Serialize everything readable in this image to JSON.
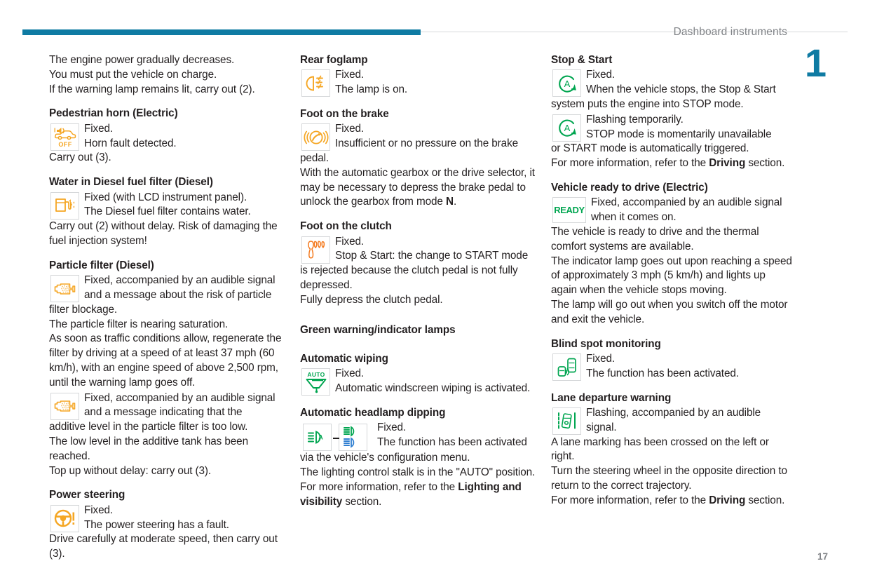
{
  "header": {
    "title": "Dashboard instruments",
    "chapter": "1",
    "page": "17"
  },
  "colors": {
    "accent": "#0f7ba3",
    "amber": "#f5a623",
    "green": "#00a550",
    "header_text": "#808387",
    "body_text": "#231f20",
    "icon_border": "#d5d7d9"
  },
  "columns": [
    {
      "blocks": [
        {
          "type": "paragraph",
          "text": "The engine power gradually decreases."
        },
        {
          "type": "paragraph",
          "text": "You must put the vehicle on charge."
        },
        {
          "type": "paragraph",
          "text": "If the warning lamp remains lit, carry out (2)."
        },
        {
          "type": "heading",
          "text": "Pedestrian horn (Electric)"
        },
        {
          "type": "lamp",
          "icon": "pedestrian-horn-off-icon",
          "line1": "Fixed.",
          "line2": "Horn fault detected."
        },
        {
          "type": "paragraph",
          "text": "Carry out (3)."
        },
        {
          "type": "heading",
          "text": "Water in Diesel fuel filter (Diesel)"
        },
        {
          "type": "lamp",
          "icon": "diesel-fuel-filter-water-icon",
          "line1": "Fixed (with LCD instrument panel).",
          "line2": "The Diesel fuel filter contains water."
        },
        {
          "type": "paragraph",
          "text": "Carry out (2) without delay. Risk of damaging the fuel injection system!"
        },
        {
          "type": "heading",
          "text": "Particle filter (Diesel)"
        },
        {
          "type": "lamp",
          "icon": "particle-filter-icon",
          "line1": "Fixed, accompanied by an audible signal",
          "line2": "and a message about the risk of particle"
        },
        {
          "type": "paragraph",
          "text": "filter blockage."
        },
        {
          "type": "paragraph",
          "text": "The particle filter is nearing saturation."
        },
        {
          "type": "paragraph",
          "text": "As soon as traffic conditions allow, regenerate the filter by driving at a speed of at least 37 mph (60 km/h), with an engine speed of above 2,500 rpm, until the warning lamp goes off."
        },
        {
          "type": "lamp",
          "icon": "particle-filter-additive-icon",
          "line1": "Fixed, accompanied by an audible signal",
          "line2": "and a message indicating that the"
        },
        {
          "type": "paragraph",
          "text": "additive level in the particle filter is too low."
        },
        {
          "type": "paragraph",
          "text": "The low level in the additive tank has been reached."
        },
        {
          "type": "paragraph",
          "text": "Top up without delay: carry out (3)."
        },
        {
          "type": "heading",
          "text": "Power steering"
        },
        {
          "type": "lamp",
          "icon": "power-steering-fault-icon",
          "line1": "Fixed.",
          "line2": "The power steering has a fault."
        },
        {
          "type": "paragraph",
          "text": "Drive carefully at moderate speed, then carry out (3)."
        }
      ]
    },
    {
      "blocks": [
        {
          "type": "heading",
          "text": "Rear foglamp"
        },
        {
          "type": "lamp",
          "icon": "rear-foglamp-icon",
          "line1": "Fixed.",
          "line2": "The lamp is on."
        },
        {
          "type": "heading",
          "text": "Foot on the brake"
        },
        {
          "type": "lamp",
          "icon": "foot-on-brake-icon",
          "line1": "Fixed.",
          "line2": "Insufficient or no pressure on the brake"
        },
        {
          "type": "paragraph",
          "text": "pedal."
        },
        {
          "type": "paragraph_rich",
          "text_pre": "With the automatic gearbox or the drive selector, it may be necessary to depress the brake pedal to unlock the gearbox from mode ",
          "bold": "N",
          "text_post": "."
        },
        {
          "type": "heading",
          "text": "Foot on the clutch"
        },
        {
          "type": "lamp",
          "icon": "foot-on-clutch-icon",
          "line1": "Fixed.",
          "line2": "Stop & Start: the change to START mode"
        },
        {
          "type": "paragraph",
          "text": "is rejected because the clutch pedal is not fully depressed."
        },
        {
          "type": "paragraph",
          "text": "Fully depress the clutch pedal."
        },
        {
          "type": "heading_big",
          "text": "Green warning/indicator lamps"
        },
        {
          "type": "heading",
          "text": "Automatic wiping"
        },
        {
          "type": "lamp",
          "icon": "automatic-wiping-icon",
          "line1": "Fixed.",
          "line2": "Automatic windscreen wiping is activated."
        },
        {
          "type": "heading",
          "text": "Automatic headlamp dipping"
        },
        {
          "type": "lamp_pair",
          "icon1": "auto-headlamp-a-icon",
          "icon2": "auto-headlamp-dip-icon",
          "line1": "Fixed.",
          "line2": "The function has been activated"
        },
        {
          "type": "paragraph",
          "text": "via the vehicle's configuration menu."
        },
        {
          "type": "paragraph",
          "text": "The lighting control stalk is in the \"AUTO\" position."
        },
        {
          "type": "paragraph_rich",
          "text_pre": "For more information, refer to the ",
          "bold": "Lighting and visibility",
          "text_post": " section."
        }
      ]
    },
    {
      "blocks": [
        {
          "type": "heading",
          "text": "Stop & Start"
        },
        {
          "type": "lamp",
          "icon": "stop-start-icon",
          "line1": "Fixed.",
          "line2": "When the vehicle stops, the Stop & Start"
        },
        {
          "type": "paragraph",
          "text": "system puts the engine into STOP mode."
        },
        {
          "type": "lamp",
          "icon": "stop-start-icon",
          "line1": "Flashing temporarily.",
          "line2": "STOP mode is momentarily unavailable"
        },
        {
          "type": "paragraph",
          "text": "or START mode is automatically triggered."
        },
        {
          "type": "paragraph_rich",
          "text_pre": "For more information, refer to the ",
          "bold": "Driving",
          "text_post": " section."
        },
        {
          "type": "heading",
          "text": "Vehicle ready to drive (Electric)"
        },
        {
          "type": "lamp",
          "icon": "ready-icon",
          "line1": "Fixed, accompanied by an audible signal",
          "line2": "when it comes on."
        },
        {
          "type": "paragraph",
          "text": "The vehicle is ready to drive and the thermal comfort systems are available."
        },
        {
          "type": "paragraph",
          "text": "The indicator lamp goes out upon reaching a speed of approximately 3 mph (5 km/h) and lights up again when the vehicle stops moving."
        },
        {
          "type": "paragraph",
          "text": "The lamp will go out when you switch off the motor and exit the vehicle."
        },
        {
          "type": "heading",
          "text": "Blind spot monitoring"
        },
        {
          "type": "lamp",
          "icon": "blind-spot-monitoring-icon",
          "line1": "Fixed.",
          "line2": "The function has been activated."
        },
        {
          "type": "heading",
          "text": "Lane departure warning"
        },
        {
          "type": "lamp",
          "icon": "lane-departure-warning-icon",
          "line1": "Flashing, accompanied by an audible",
          "line2": "signal."
        },
        {
          "type": "paragraph",
          "text": "A lane marking has been crossed on the left or right."
        },
        {
          "type": "paragraph",
          "text": "Turn the steering wheel in the opposite direction to return to the correct trajectory."
        },
        {
          "type": "paragraph_rich",
          "text_pre": "For more information, refer to the ",
          "bold": "Driving",
          "text_post": " section."
        }
      ]
    }
  ],
  "icon_labels": {
    "off": "OFF",
    "auto": "AUTO",
    "ready": "READY",
    "stop_start_a": "A",
    "headlamp_a": "A"
  }
}
